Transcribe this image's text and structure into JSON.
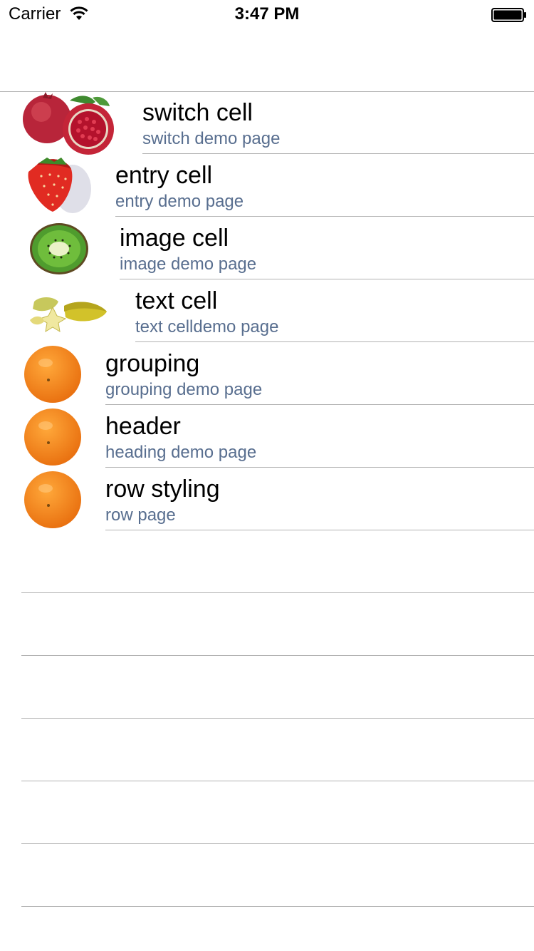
{
  "status_bar": {
    "carrier": "Carrier",
    "time": "3:47 PM"
  },
  "rows": [
    {
      "title": "switch cell",
      "subtitle": "switch demo page",
      "icon": "pomegranate-icon"
    },
    {
      "title": "entry cell",
      "subtitle": "entry demo page",
      "icon": "strawberry-icon"
    },
    {
      "title": "image cell",
      "subtitle": "image demo page",
      "icon": "kiwi-icon"
    },
    {
      "title": "text cell",
      "subtitle": "text celldemo page",
      "icon": "starfruit-icon"
    },
    {
      "title": "grouping",
      "subtitle": "grouping demo page",
      "icon": "orange-icon"
    },
    {
      "title": "header",
      "subtitle": "heading demo page",
      "icon": "orange-icon"
    },
    {
      "title": "row styling",
      "subtitle": "row page",
      "icon": "orange-icon"
    }
  ],
  "colors": {
    "subtitle": "#586e8f",
    "separator": "#b2b2b2"
  }
}
